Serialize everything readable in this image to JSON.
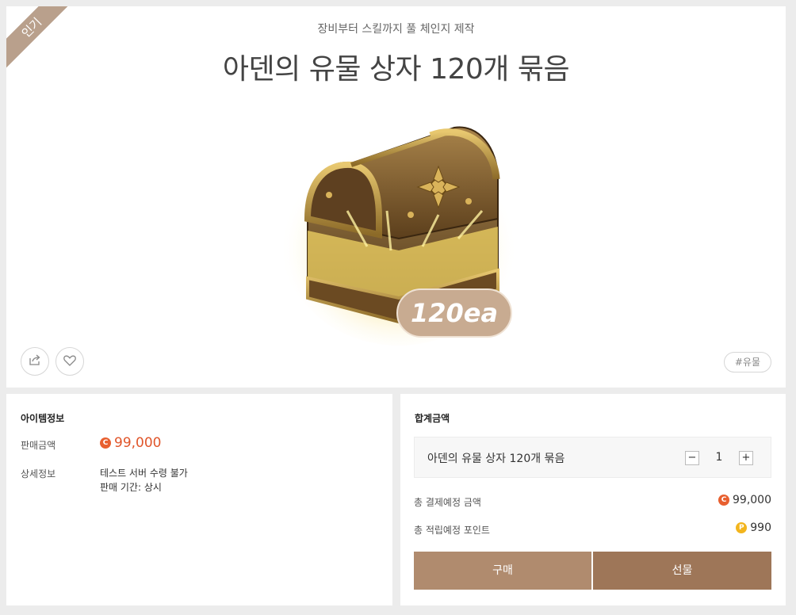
{
  "product": {
    "ribbon": "인기",
    "subtitle": "장비부터 스킬까지 풀 체인지 제작",
    "title": "아덴의 유물 상자 120개 묶음",
    "badge": "120ea",
    "tag": "#유물"
  },
  "item_info": {
    "heading": "아이템정보",
    "price_label": "판매금액",
    "price": "99,000",
    "detail_label": "상세정보",
    "detail_lines": [
      "테스트 서버 수령 불가",
      "판매 기간: 상시"
    ]
  },
  "total": {
    "heading": "합계금액",
    "selected_name": "아덴의 유물 상자 120개 묶음",
    "quantity": "1",
    "minus": "−",
    "plus": "+",
    "pay_label": "총 결제예정 금액",
    "pay_value": "99,000",
    "point_label": "총 적립예정 포인트",
    "point_value": "990",
    "coin_c": "C",
    "coin_p": "P",
    "buy_label": "구매",
    "gift_label": "선물"
  },
  "icons": {
    "share": "share-icon",
    "heart": "heart-icon",
    "chest": "treasure-chest-image"
  },
  "colors": {
    "accent_price": "#e0552a",
    "buy": "#b08b6e",
    "gift": "#9e7658",
    "ribbon": "#b9a08c"
  }
}
